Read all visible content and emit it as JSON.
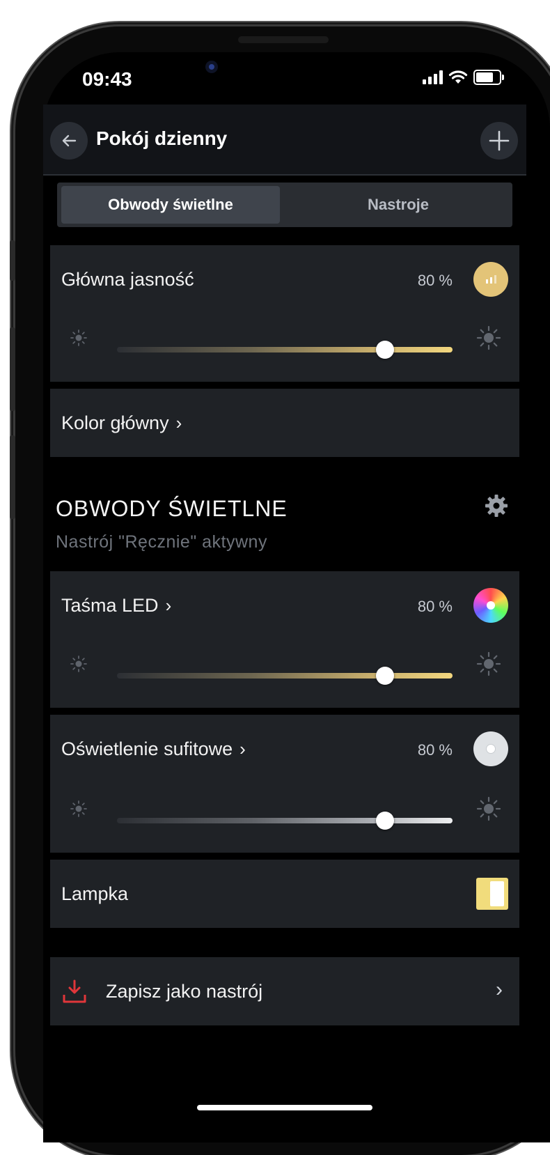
{
  "status_bar": {
    "time": "09:43"
  },
  "header": {
    "title": "Pokój dzienny"
  },
  "tabs": [
    {
      "label": "Obwody świetlne",
      "active": true
    },
    {
      "label": "Nastroje",
      "active": false
    }
  ],
  "main_brightness": {
    "label": "Główna jasność",
    "percent": "80 %",
    "level": 0.8,
    "accent": "#e3c478"
  },
  "main_color": {
    "label": "Kolor główny"
  },
  "circuits": {
    "title": "OBWODY ŚWIETLNE",
    "subtitle": "Nastrój \"Ręcznie\" aktywny",
    "items": [
      {
        "label": "Taśma LED",
        "percent": "80 %",
        "level": 0.8,
        "icon": "rgb-color-wheel-icon"
      },
      {
        "label": "Oświetlenie sufitowe",
        "percent": "80 %",
        "level": 0.8,
        "icon": "white-light-icon"
      },
      {
        "label": "Lampka",
        "icon": "toggle-switch-icon",
        "on": true
      }
    ]
  },
  "save_mood": {
    "label": "Zapisz jako nastrój",
    "icon_color": "#e0363a"
  }
}
